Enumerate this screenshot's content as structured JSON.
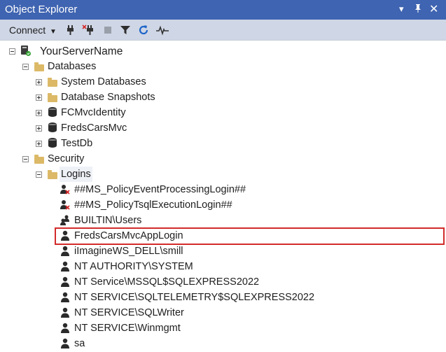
{
  "window": {
    "title": "Object Explorer"
  },
  "toolbar": {
    "connect_label": "Connect",
    "buttons": [
      "connect-icon",
      "disconnect-icon",
      "stop-icon",
      "filter-icon",
      "refresh-icon",
      "activity-monitor-icon"
    ]
  },
  "tree": {
    "server": "YourServerName",
    "databases": {
      "label": "Databases",
      "children": [
        "System Databases",
        "Database Snapshots",
        "FCMvcIdentity",
        "FredsCarsMvc",
        "TestDb"
      ]
    },
    "security": {
      "label": "Security",
      "logins_label": "Logins",
      "logins": [
        "##MS_PolicyEventProcessingLogin##",
        "##MS_PolicyTsqlExecutionLogin##",
        "BUILTIN\\Users",
        "FredsCarsMvcAppLogin",
        "iImagineWS_DELL\\smill",
        "NT AUTHORITY\\SYSTEM",
        "NT Service\\MSSQL$SQLEXPRESS2022",
        "NT SERVICE\\SQLTELEMETRY$SQLEXPRESS2022",
        "NT SERVICE\\SQLWriter",
        "NT SERVICE\\Winmgmt",
        "sa"
      ]
    }
  },
  "highlighted_login": "FredsCarsMvcAppLogin",
  "colors": {
    "titlebar": "#3f64b1",
    "toolbar": "#cfd6e5",
    "highlight_border": "#d32a2a",
    "folder": "#dcb967"
  }
}
